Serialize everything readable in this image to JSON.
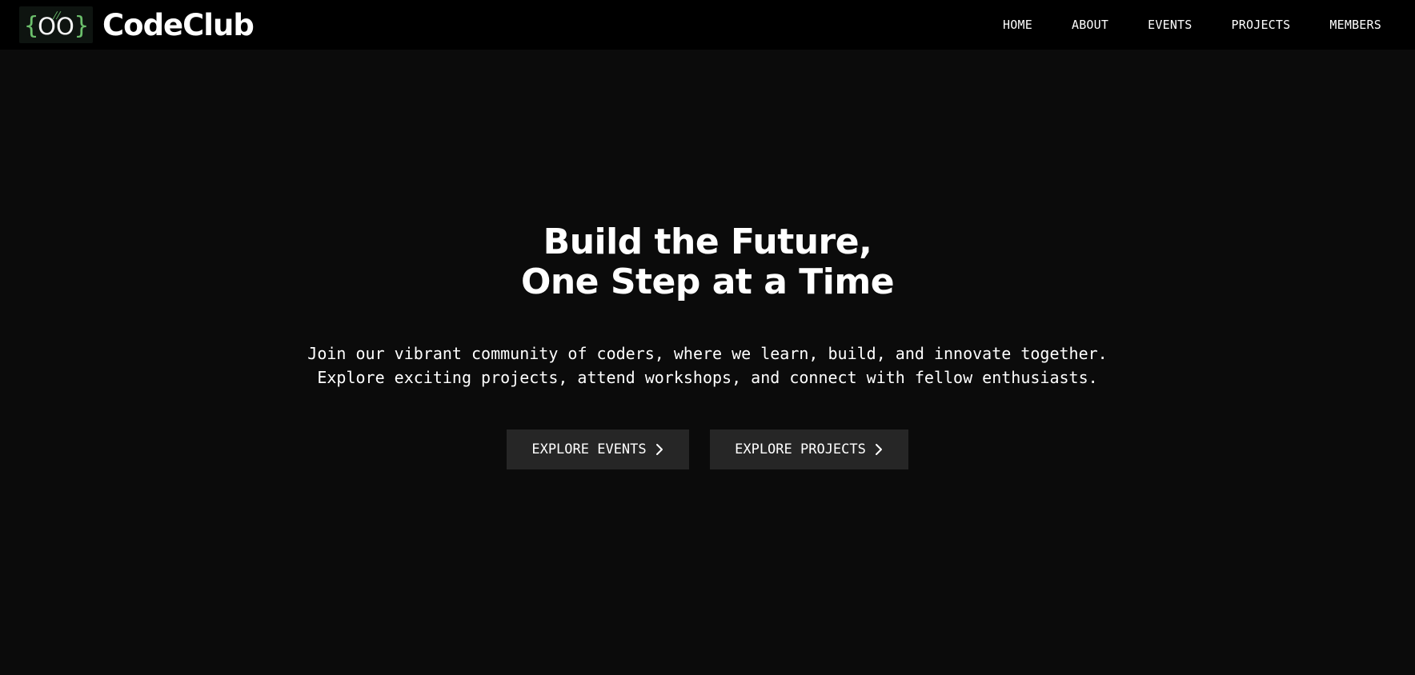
{
  "brand": {
    "logo_left_brace": "{",
    "logo_eyes": "OO",
    "logo_right_brace": "}",
    "logo_tick": "//",
    "name": "CodeClub",
    "accent_color": "#6cc06c"
  },
  "nav": {
    "items": [
      {
        "label": "HOME"
      },
      {
        "label": "ABOUT"
      },
      {
        "label": "EVENTS"
      },
      {
        "label": "PROJECTS"
      },
      {
        "label": "MEMBERS"
      }
    ]
  },
  "hero": {
    "title_line1": "Build the Future,",
    "title_line2": "One Step at a Time",
    "subtitle_line1": "Join our vibrant community of coders, where we learn, build, and innovate together.",
    "subtitle_line2": "Explore exciting projects, attend workshops, and connect with fellow enthusiasts.",
    "buttons": [
      {
        "label": "EXPLORE EVENTS",
        "icon": "chevron-right-icon"
      },
      {
        "label": "EXPLORE PROJECTS",
        "icon": "chevron-right-icon"
      }
    ]
  },
  "colors": {
    "navbar_bg": "#000000",
    "page_bg": "#0b0b0b",
    "button_bg": "#262626",
    "text": "#ffffff"
  }
}
